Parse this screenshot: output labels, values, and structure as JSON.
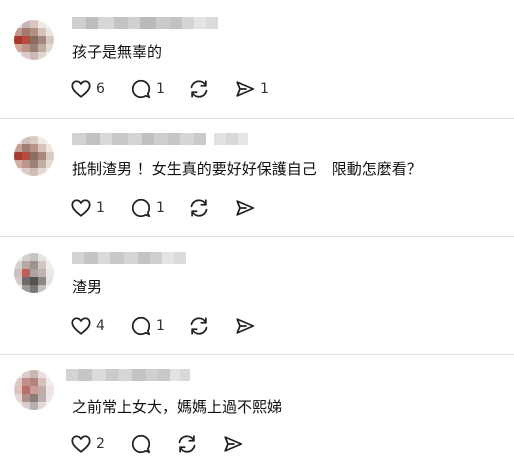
{
  "comments": [
    {
      "text": "孩子是無辜的",
      "likes": "6",
      "replies": "1",
      "reposts": "",
      "shares": "1"
    },
    {
      "text": "抵制渣男 ！女生真的要好好保護自己　限動怎麼看？",
      "likes": "1",
      "replies": "1",
      "reposts": "",
      "shares": ""
    },
    {
      "text": "渣男",
      "likes": "4",
      "replies": "1",
      "reposts": "",
      "shares": ""
    },
    {
      "text": "之前常上女大，媽媽上過不熙娣",
      "likes": "2",
      "replies": "",
      "reposts": "",
      "shares": ""
    }
  ],
  "icons": [
    "heart-icon",
    "comment-icon",
    "repost-icon",
    "share-icon"
  ]
}
